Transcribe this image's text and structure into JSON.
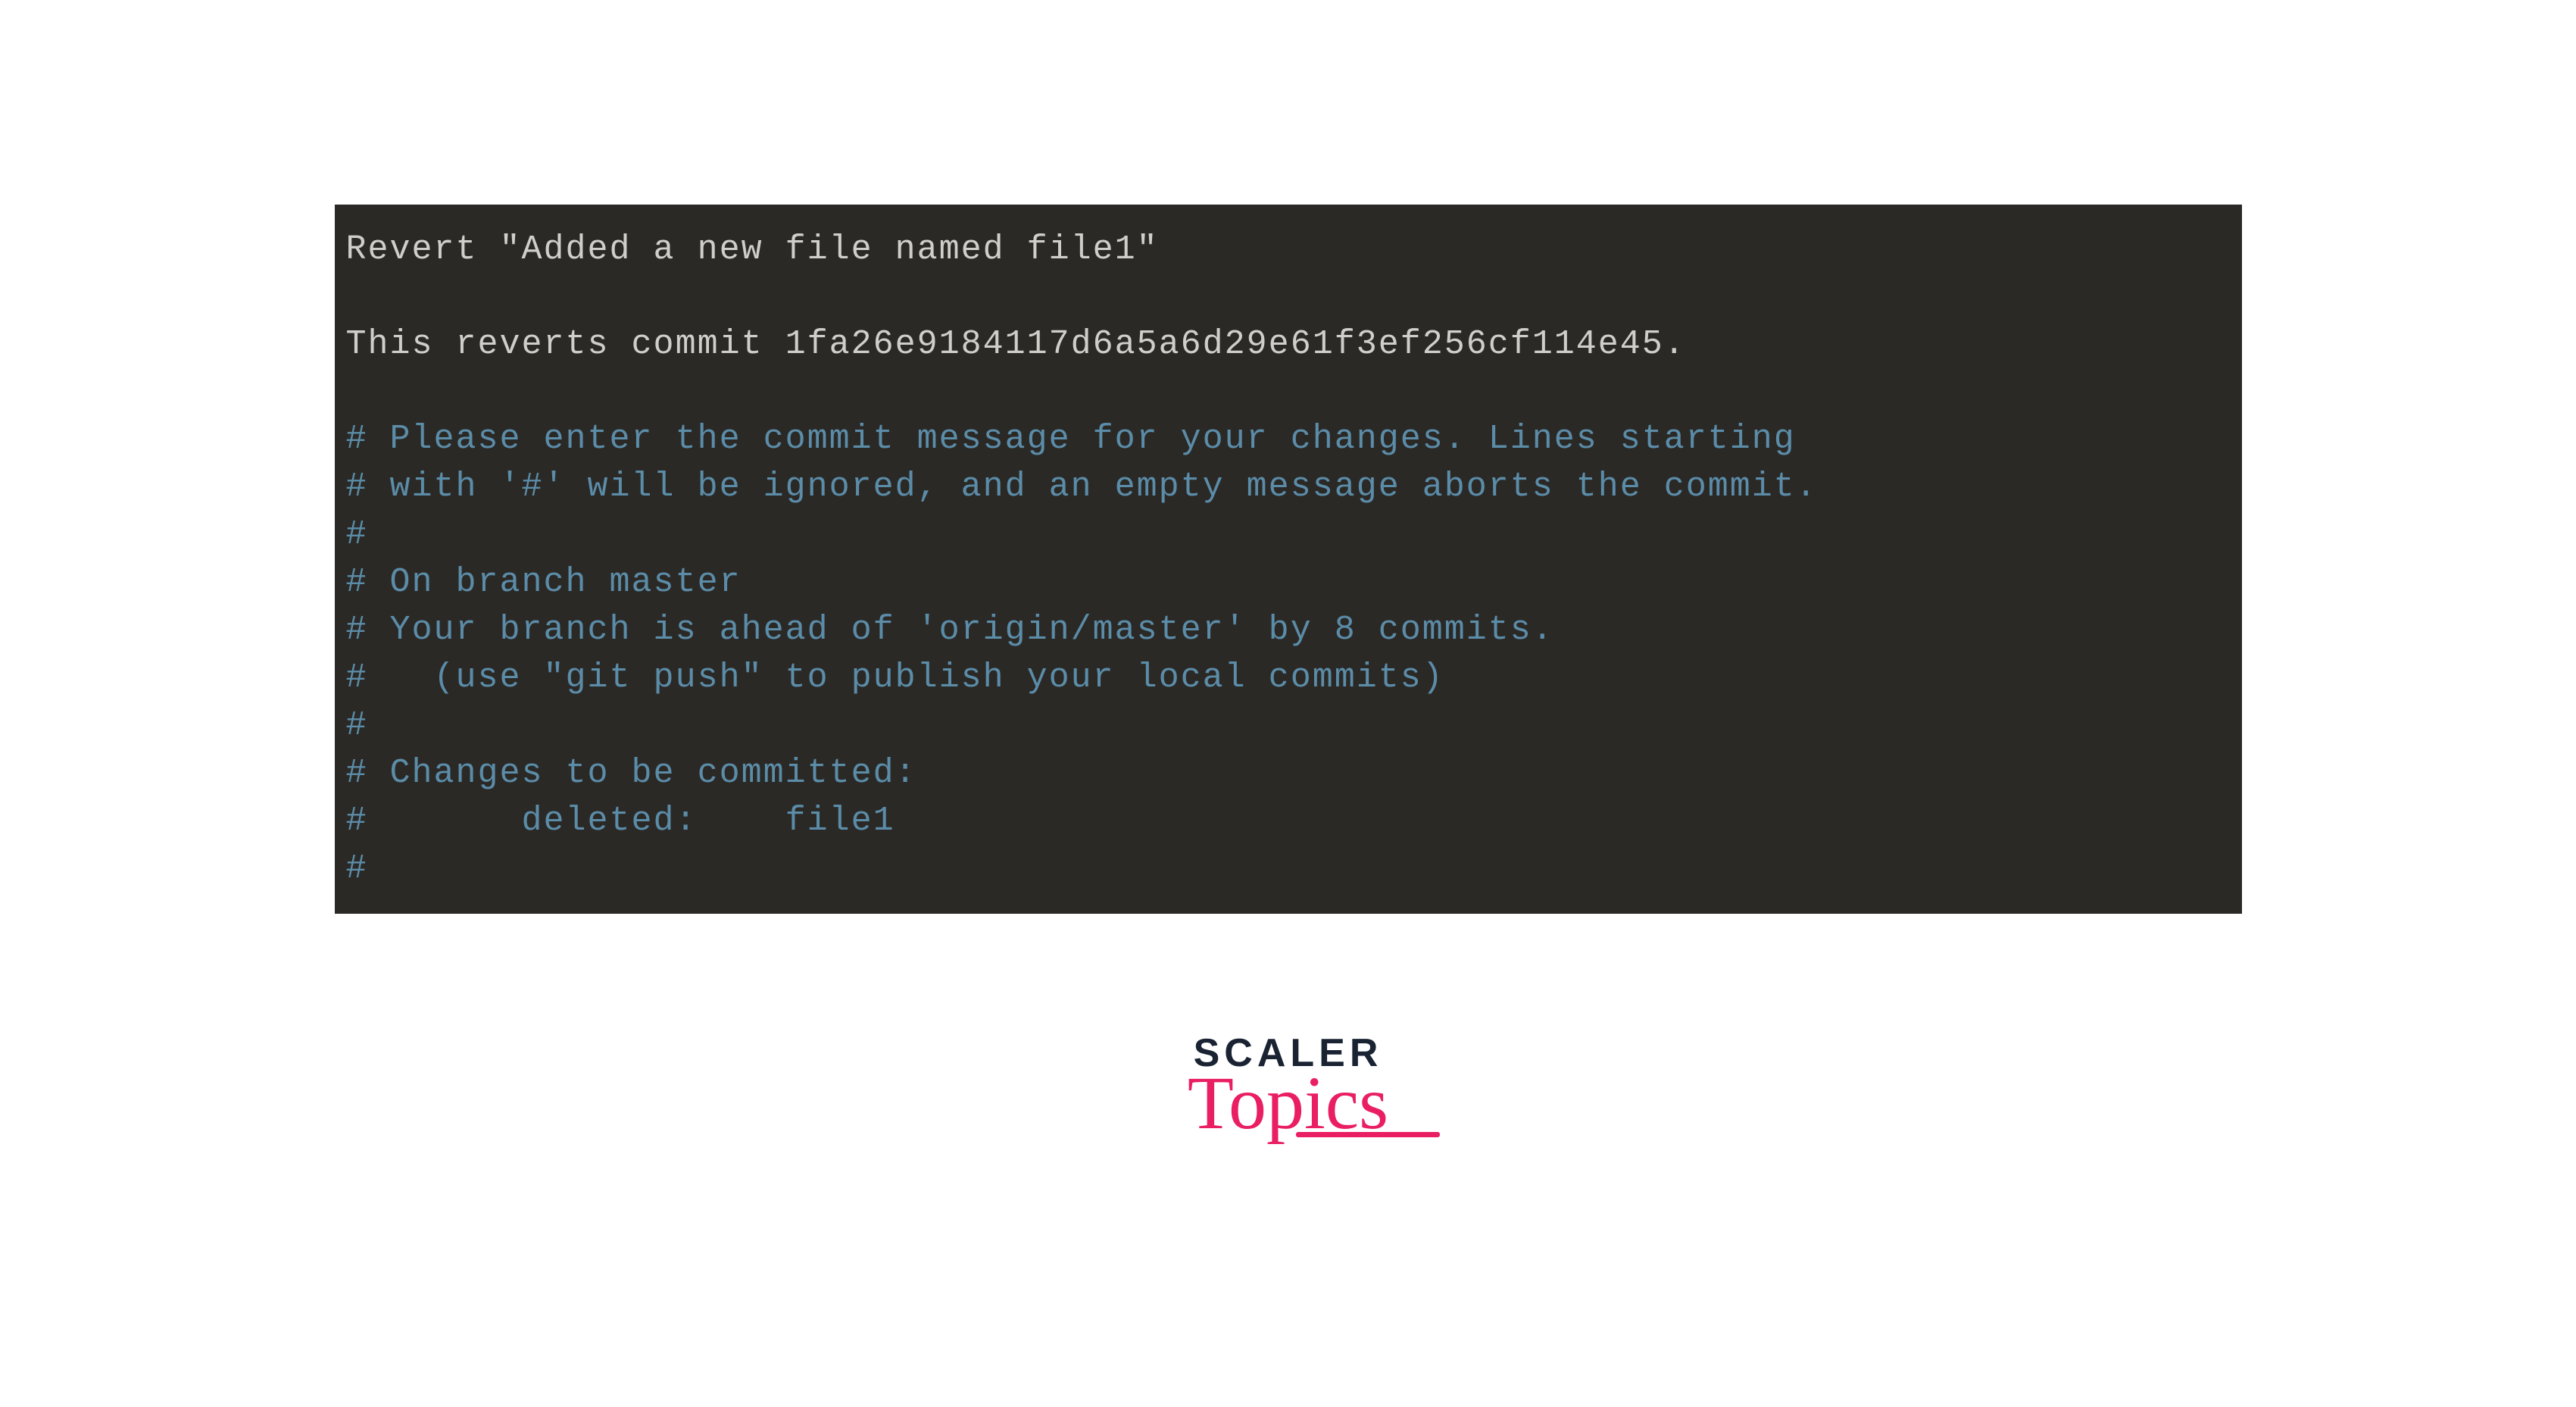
{
  "terminal": {
    "lines": [
      {
        "type": "msg",
        "text": "Revert \"Added a new file named file1\""
      },
      {
        "type": "blank",
        "text": ""
      },
      {
        "type": "msg",
        "text": "This reverts commit 1fa26e9184117d6a5a6d29e61f3ef256cf114e45."
      },
      {
        "type": "blank",
        "text": ""
      },
      {
        "type": "comment",
        "text": "# Please enter the commit message for your changes. Lines starting"
      },
      {
        "type": "comment",
        "text": "# with '#' will be ignored, and an empty message aborts the commit."
      },
      {
        "type": "comment",
        "text": "#"
      },
      {
        "type": "comment",
        "text": "# On branch master"
      },
      {
        "type": "comment",
        "text": "# Your branch is ahead of 'origin/master' by 8 commits."
      },
      {
        "type": "comment",
        "text": "#   (use \"git push\" to publish your local commits)"
      },
      {
        "type": "comment",
        "text": "#"
      },
      {
        "type": "comment",
        "text": "# Changes to be committed:"
      },
      {
        "type": "comment",
        "text": "#       deleted:    file1"
      },
      {
        "type": "comment",
        "text": "#"
      }
    ]
  },
  "logo": {
    "top": "SCALER",
    "bottom": "Topics"
  }
}
